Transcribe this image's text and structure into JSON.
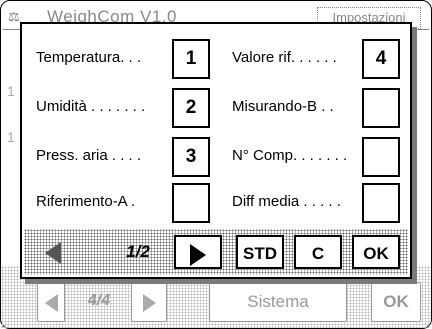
{
  "background": {
    "title": "WeighCom V1.0",
    "tab": "Impostazioni",
    "side_glyph_1": "1",
    "side_glyph_2": "1",
    "pager": "4/4",
    "sistema_button": "Sistema",
    "ok_button": "OK"
  },
  "dialog": {
    "fields_left": [
      {
        "label": "Temperatura. . .",
        "value": "1"
      },
      {
        "label": "Umidità . . . . . . .",
        "value": "2"
      },
      {
        "label": "Press. aria . . . .",
        "value": "3"
      },
      {
        "label": "Riferimento-A .",
        "value": ""
      }
    ],
    "fields_right": [
      {
        "label": "Valore rif. . . . . .",
        "value": "4"
      },
      {
        "label": "Misurando-B . .",
        "value": ""
      },
      {
        "label": "N° Comp. . . . . . .",
        "value": ""
      },
      {
        "label": "Diff media . . . . .",
        "value": ""
      }
    ],
    "footer": {
      "page_indicator": "1/2",
      "std_label": "STD",
      "clear_label": "C",
      "ok_label": "OK"
    }
  }
}
